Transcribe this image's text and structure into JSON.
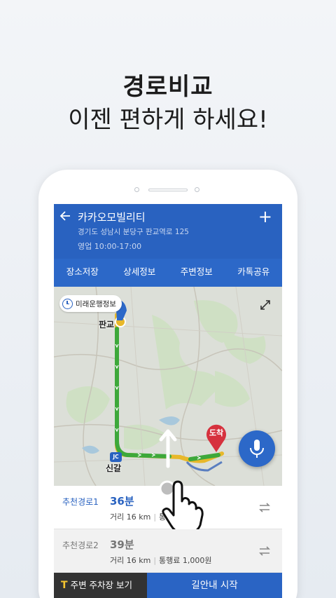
{
  "headline": {
    "line1": "경로비교",
    "line2": "이젠 편하게 하세요!"
  },
  "place": {
    "name": "카카오모빌리티",
    "address": "경기도 성남시 분당구 판교역로 125",
    "hours": "영업 10:00-17:00"
  },
  "tabs": [
    {
      "label": "장소저장"
    },
    {
      "label": "상세정보"
    },
    {
      "label": "주변정보"
    },
    {
      "label": "카톡공유"
    }
  ],
  "map": {
    "future_info_label": "미래운행정보",
    "origin_label": "판교",
    "junction_label": "신갈",
    "junction_badge": "JC",
    "destination_label": "도착"
  },
  "routes": [
    {
      "name": "추천경로1",
      "time": "36분",
      "distance": "거리 16 km",
      "toll": "통"
    },
    {
      "name": "추천경로2",
      "time": "39분",
      "distance": "거리 16 km",
      "toll": "통행료 1,000원"
    }
  ],
  "bottom": {
    "parking_label": "주변 주차장 보기",
    "parking_icon": "T",
    "start_label": "길안내 시작"
  },
  "colors": {
    "primary": "#2962c0",
    "route_green": "#3da83a",
    "route_yellow": "#e8b82a",
    "destination_red": "#d6313d"
  },
  "icons": [
    "back-arrow-icon",
    "plus-icon",
    "clock-icon",
    "expand-icon",
    "destination-pin-icon",
    "mic-icon",
    "swap-icon",
    "parking-icon",
    "hand-pointer-icon",
    "swipe-up-arrow-icon"
  ]
}
